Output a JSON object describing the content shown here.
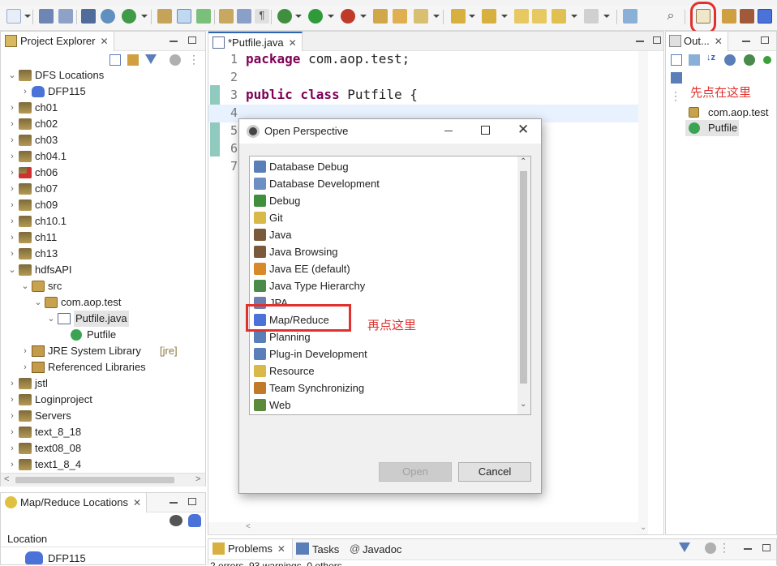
{
  "colors": {
    "annotation": "#e0312e",
    "highlight": "#cfe3f6",
    "selected": "#e4e4e4"
  },
  "project_explorer": {
    "title": "Project Explorer",
    "items": [
      {
        "label": "DFS Locations",
        "depth": 0,
        "expanded": true,
        "icon": "folder-icon"
      },
      {
        "label": "DFP115",
        "depth": 1,
        "expanded": false,
        "icon": "hadoop-elephant-icon"
      },
      {
        "label": "ch01",
        "depth": 0,
        "expanded": false,
        "icon": "project-icon"
      },
      {
        "label": "ch02",
        "depth": 0,
        "expanded": false,
        "icon": "project-icon"
      },
      {
        "label": "ch03",
        "depth": 0,
        "expanded": false,
        "icon": "project-icon"
      },
      {
        "label": "ch04.1",
        "depth": 0,
        "expanded": false,
        "icon": "project-icon"
      },
      {
        "label": "ch06",
        "depth": 0,
        "expanded": false,
        "icon": "project-error-icon"
      },
      {
        "label": "ch07",
        "depth": 0,
        "expanded": false,
        "icon": "project-icon"
      },
      {
        "label": "ch09",
        "depth": 0,
        "expanded": false,
        "icon": "project-icon"
      },
      {
        "label": "ch10.1",
        "depth": 0,
        "expanded": false,
        "icon": "project-icon"
      },
      {
        "label": "ch11",
        "depth": 0,
        "expanded": false,
        "icon": "project-icon"
      },
      {
        "label": "ch13",
        "depth": 0,
        "expanded": false,
        "icon": "project-icon"
      },
      {
        "label": "hdfsAPI",
        "depth": 0,
        "expanded": true,
        "icon": "project-icon"
      },
      {
        "label": "src",
        "depth": 1,
        "expanded": true,
        "icon": "source-folder-icon"
      },
      {
        "label": "com.aop.test",
        "depth": 2,
        "expanded": true,
        "icon": "package-icon"
      },
      {
        "label": "Putfile.java",
        "depth": 3,
        "expanded": true,
        "icon": "java-file-icon",
        "selected": true
      },
      {
        "label": "Putfile",
        "depth": 4,
        "expanded": null,
        "icon": "class-icon"
      },
      {
        "label": "JRE System Library",
        "suffix": "[jre]",
        "depth": 1,
        "expanded": false,
        "icon": "library-icon"
      },
      {
        "label": "Referenced Libraries",
        "depth": 1,
        "expanded": false,
        "icon": "library-icon"
      },
      {
        "label": "jstl",
        "depth": 0,
        "expanded": false,
        "icon": "project-icon"
      },
      {
        "label": "Loginproject",
        "depth": 0,
        "expanded": false,
        "icon": "project-icon"
      },
      {
        "label": "Servers",
        "depth": 0,
        "expanded": false,
        "icon": "project-icon"
      },
      {
        "label": "text_8_18",
        "depth": 0,
        "expanded": false,
        "icon": "project-icon"
      },
      {
        "label": "text08_08",
        "depth": 0,
        "expanded": false,
        "icon": "project-icon"
      },
      {
        "label": "text1_8_4",
        "depth": 0,
        "expanded": false,
        "icon": "project-icon"
      }
    ]
  },
  "mr_locations": {
    "title": "Map/Reduce Locations",
    "column": "Location",
    "row": "DFP115"
  },
  "editor": {
    "tab": "*Putfile.java",
    "line_numbers": [
      "1",
      "2",
      "3",
      "4",
      "5",
      "6",
      "7"
    ],
    "lines": [
      {
        "kw": "package",
        "rest": " com.aop.test;"
      },
      {
        "kw": "",
        "rest": ""
      },
      {
        "kw": "public class",
        "rest": " Putfile {"
      },
      {
        "kw": "",
        "rest": ""
      },
      {
        "kw": "",
        "rest": ""
      },
      {
        "kw": "",
        "rest": ""
      },
      {
        "kw": "",
        "rest": ""
      }
    ]
  },
  "outline": {
    "title": "Out...",
    "items": [
      {
        "label": "com.aop.test",
        "icon": "package-icon"
      },
      {
        "label": "Putfile",
        "icon": "class-icon"
      }
    ]
  },
  "bottom_tabs": [
    {
      "label": "Problems",
      "icon": "problems-icon"
    },
    {
      "label": "Tasks",
      "icon": "tasks-icon"
    },
    {
      "label": "Javadoc",
      "icon": "at-icon"
    }
  ],
  "status_text": "2 errors, 93 warnings, 0 others",
  "dialog": {
    "title": "Open Perspective",
    "items": [
      {
        "label": "Database Debug",
        "icon": "database-debug-icon",
        "color": "#5a7fb8"
      },
      {
        "label": "Database Development",
        "icon": "database-icon",
        "color": "#6d8fc4"
      },
      {
        "label": "Debug",
        "icon": "bug-icon",
        "color": "#3f8f3f"
      },
      {
        "label": "Git",
        "icon": "git-icon",
        "color": "#d8b94a"
      },
      {
        "label": "Java",
        "icon": "java-icon",
        "color": "#7a5a3a"
      },
      {
        "label": "Java Browsing",
        "icon": "java-browsing-icon",
        "color": "#7a5a3a"
      },
      {
        "label": "Java EE (default)",
        "icon": "java-ee-icon",
        "color": "#d88a2a"
      },
      {
        "label": "Java Type Hierarchy",
        "icon": "hierarchy-icon",
        "color": "#4a8a4a"
      },
      {
        "label": "JPA",
        "icon": "jpa-icon",
        "color": "#6b7fb0"
      },
      {
        "label": "Map/Reduce",
        "icon": "hadoop-elephant-icon",
        "color": "#4a72d8"
      },
      {
        "label": "Planning",
        "icon": "planning-icon",
        "color": "#5a7fb8"
      },
      {
        "label": "Plug-in Development",
        "icon": "plugin-icon",
        "color": "#5a7fb8"
      },
      {
        "label": "Resource",
        "icon": "folder-icon",
        "color": "#d8b94a"
      },
      {
        "label": "Team Synchronizing",
        "icon": "sync-icon",
        "color": "#c07a2a"
      },
      {
        "label": "Web",
        "icon": "globe-icon",
        "color": "#5a8a3a"
      }
    ],
    "open": "Open",
    "cancel": "Cancel"
  },
  "annotations": {
    "first": "先点在这里",
    "second": "再点这里"
  }
}
